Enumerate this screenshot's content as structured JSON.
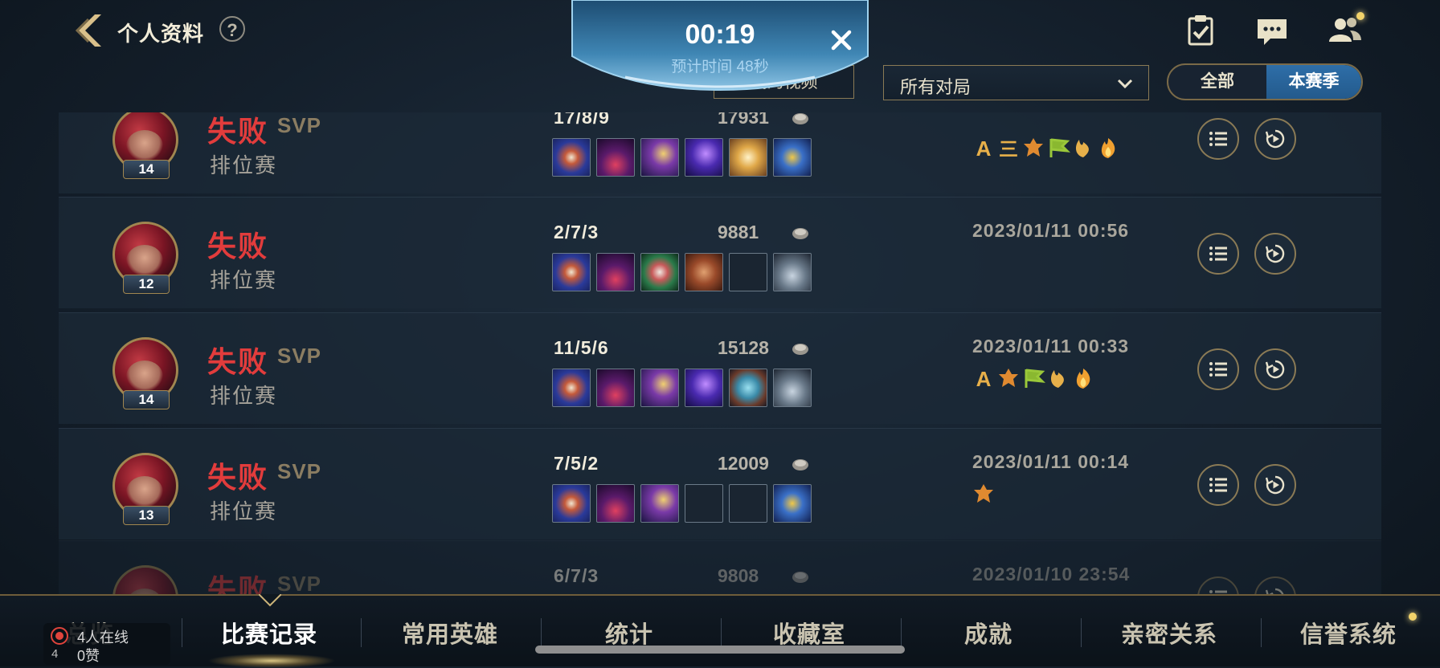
{
  "header": {
    "title": "个人资料",
    "help_label": "?"
  },
  "top_icons": [
    "task-icon",
    "chat-icon",
    "friends-icon"
  ],
  "filters": {
    "video_button": "我的视频",
    "match_filter": "所有对局",
    "segment_all": "全部",
    "segment_season": "本赛季"
  },
  "timer": {
    "value": "00:19",
    "estimate": "预计时间 48秒"
  },
  "matches": [
    {
      "result": "失败",
      "svp": "SVP",
      "mode": "排位赛",
      "level": "14",
      "kda": "17/8/9",
      "gold": "17931",
      "date": "",
      "items": [
        "staff-blue",
        "hood-purple",
        "star-staff",
        "arcane-staff",
        "winged-shield",
        "hourglass"
      ],
      "badges": [
        "A",
        "三",
        "crest",
        "flag",
        "flame-leaf",
        "fire"
      ]
    },
    {
      "result": "失败",
      "svp": "",
      "mode": "排位赛",
      "level": "12",
      "kda": "2/7/3",
      "gold": "9881",
      "date": "2023/01/11 00:56",
      "items": [
        "staff-blue",
        "hood-purple",
        "mask-green",
        "book",
        "empty",
        "helm-grey"
      ],
      "badges": []
    },
    {
      "result": "失败",
      "svp": "SVP",
      "mode": "排位赛",
      "level": "14",
      "kda": "11/5/6",
      "gold": "15128",
      "date": "2023/01/11 00:33",
      "items": [
        "staff-blue",
        "hood-purple",
        "star-staff",
        "arcane-staff",
        "armor-teal",
        "helm-grey"
      ],
      "badges": [
        "A",
        "crest",
        "flag",
        "flame-leaf",
        "fire"
      ]
    },
    {
      "result": "失败",
      "svp": "SVP",
      "mode": "排位赛",
      "level": "13",
      "kda": "7/5/2",
      "gold": "12009",
      "date": "2023/01/11 00:14",
      "items": [
        "staff-blue",
        "hood-purple",
        "star-staff",
        "empty",
        "empty",
        "hourglass"
      ],
      "badges": [
        "crest"
      ]
    },
    {
      "result": "失败",
      "svp": "SVP",
      "mode": "排位赛",
      "level": "",
      "kda": "6/7/3",
      "gold": "9808",
      "date": "2023/01/10 23:54",
      "items": [],
      "badges": []
    }
  ],
  "bottom_nav": {
    "tabs": [
      "总览",
      "比赛记录",
      "常用英雄",
      "统计",
      "收藏室",
      "成就",
      "亲密关系",
      "信誉系统"
    ],
    "active": "比赛记录"
  },
  "online": {
    "count": "4",
    "text": "4人在线",
    "likes": "0赞"
  },
  "side_id": "2818881",
  "colors": {
    "defeat": "#e23c3c",
    "accent_gold": "#8a7a55",
    "season_blue": "#2e6ea8"
  }
}
